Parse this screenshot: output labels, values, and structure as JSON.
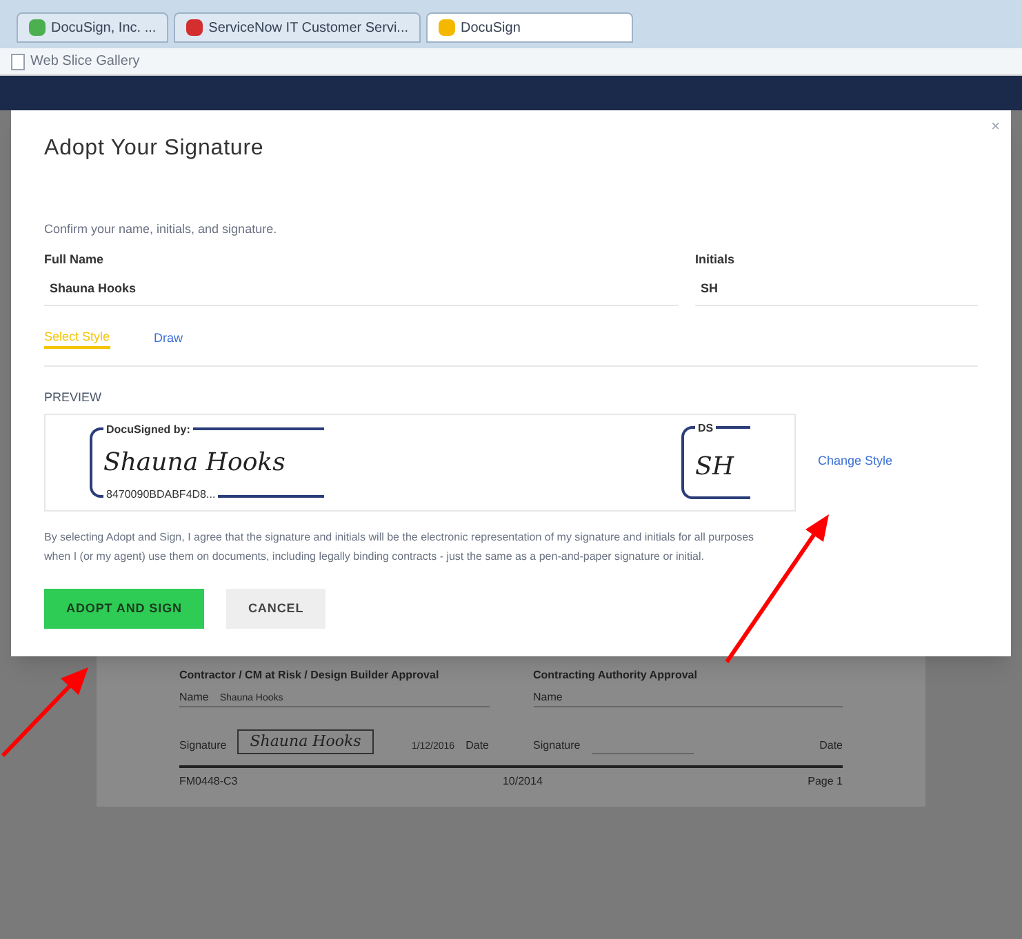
{
  "browser": {
    "tabs": [
      {
        "title": "DocuSign, Inc. ...",
        "selected": false,
        "color": "#4caf50"
      },
      {
        "title": "ServiceNow IT Customer Servi...",
        "selected": false,
        "color": "#d32f2f"
      },
      {
        "title": "DocuSign",
        "selected": true,
        "color": "#f5b800"
      }
    ],
    "favorites": "Web Slice Gallery"
  },
  "dialog": {
    "title": "Adopt Your Signature",
    "close": "×",
    "instruction": "Confirm your name, initials, and signature.",
    "fields": [
      {
        "label": "Full Name",
        "value": "Shauna Hooks"
      },
      {
        "label": "Initials",
        "value": "SH"
      }
    ],
    "tabs": [
      {
        "label": "Select Style",
        "selected": true
      },
      {
        "label": "Draw",
        "selected": false
      }
    ],
    "preview": {
      "label": "PREVIEW",
      "signature": {
        "header": "DocuSigned by:",
        "text": "Shauna Hooks",
        "id": "8470090BDABF4D8..."
      },
      "initials": {
        "header": "DS",
        "text": "SH"
      },
      "change_style": "Change Style"
    },
    "legal": "By selecting Adopt and Sign, I agree that the signature and initials will be the electronic representation of my signature and initials for all purposes when I (or my agent) use them on documents, including legally binding contracts - just the same as a pen-and-paper signature or initial.",
    "buttons": [
      {
        "label": "ADOPT AND SIGN",
        "kind": "primary"
      },
      {
        "label": "CANCEL",
        "kind": "secondary"
      }
    ]
  },
  "document": {
    "columns": [
      {
        "heading": "Contractor / CM at Risk / Design Builder Approval",
        "name_label": "Name",
        "name_value": "Shauna Hooks",
        "signature_label": "Signature",
        "signature_value": "Shauna Hooks",
        "date_label": "Date",
        "date_value": "1/12/2016",
        "signed": true
      },
      {
        "heading": "Contracting Authority Approval",
        "name_label": "Name",
        "signature_label": "Signature",
        "date_label": "Date",
        "signed": false
      }
    ],
    "footer": [
      "FM0448-C3",
      "10/2014",
      "Page 1"
    ]
  }
}
